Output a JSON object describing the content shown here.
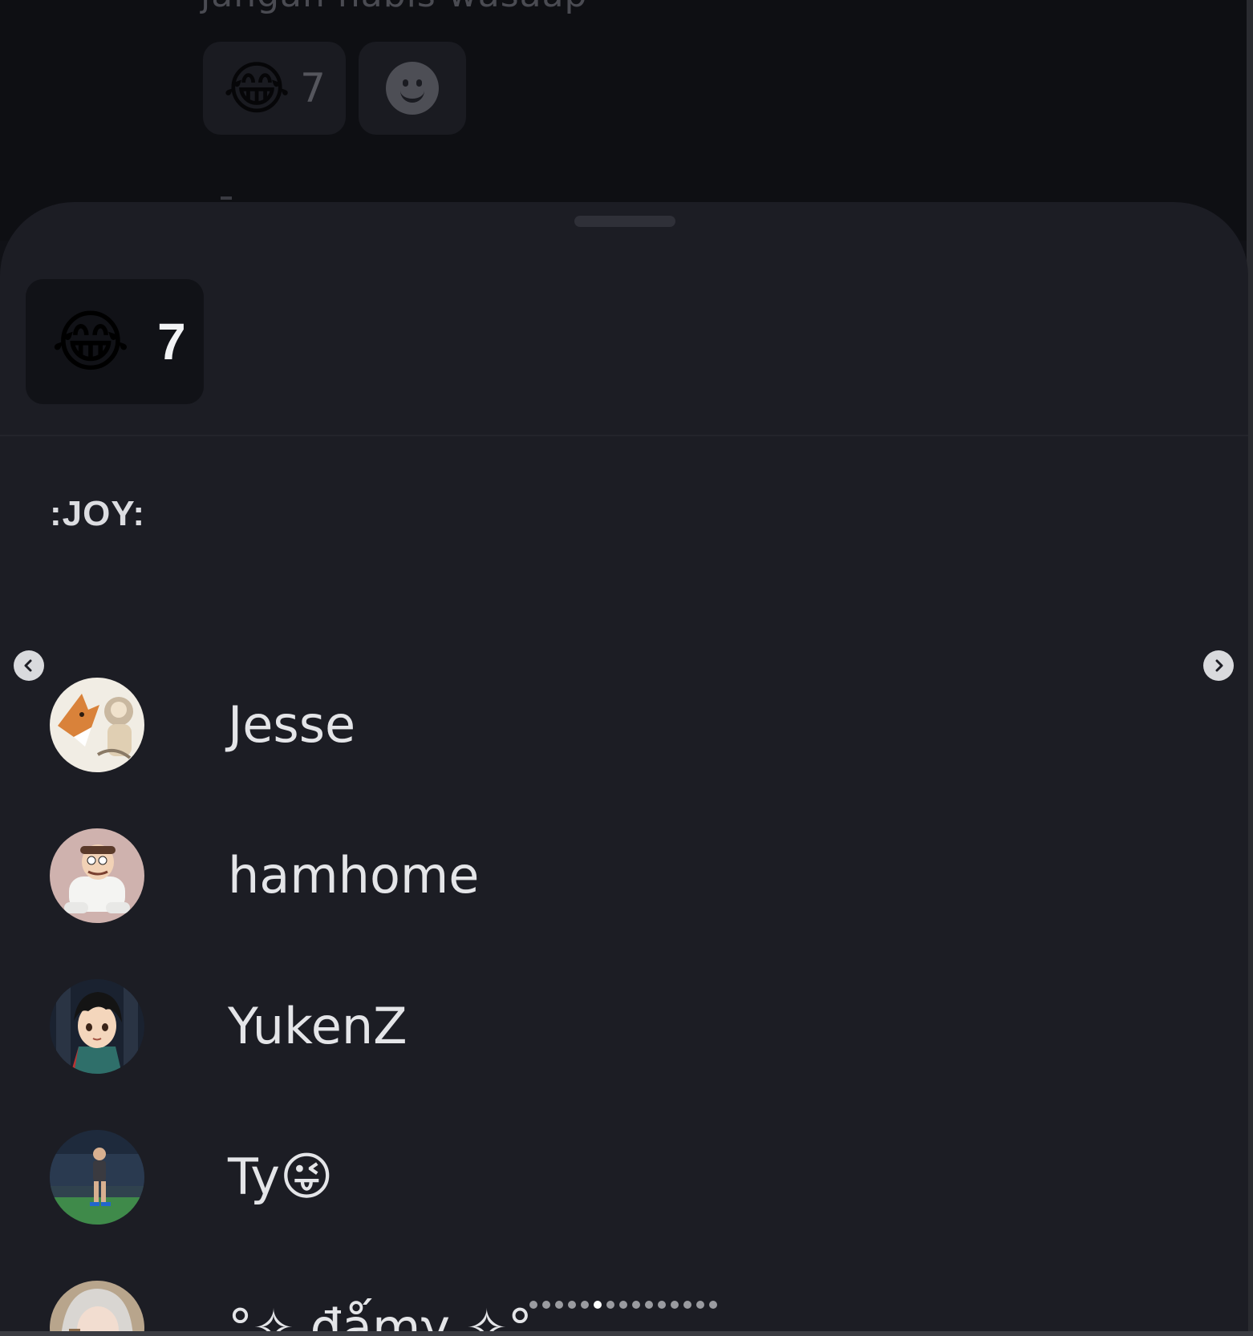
{
  "background_chat": {
    "message_text": "jangan nabis wasaap",
    "reactions": [
      {
        "emoji": "😂",
        "count": "7"
      }
    ],
    "add_reaction_icon": "add-reaction-smiley-icon"
  },
  "sheet": {
    "selected_reaction": {
      "emoji": "😂",
      "count": "7"
    },
    "emoji_name": ":JOY:",
    "users": [
      {
        "name": "Jesse",
        "emoji": "",
        "avatar": "fox-and-child-avatar"
      },
      {
        "name": "hamhome",
        "emoji": "",
        "avatar": "peter-griffin-avatar"
      },
      {
        "name": "YukenZ",
        "emoji": "",
        "avatar": "anime-boy-avatar"
      },
      {
        "name": "Ty",
        "emoji": "😜",
        "avatar": "player-on-field-avatar"
      },
      {
        "name": "°✧ đǻmγ ✧°",
        "emoji": "",
        "avatar": "anime-girl-avatar"
      }
    ]
  },
  "carousel": {
    "prev_icon": "chevron-left-icon",
    "next_icon": "chevron-right-icon",
    "dot_count": 15,
    "active_dot": 5
  },
  "colors": {
    "sheet_bg": "#1c1d24",
    "tab_bg": "#111217",
    "text_primary": "#e4e5e8"
  }
}
